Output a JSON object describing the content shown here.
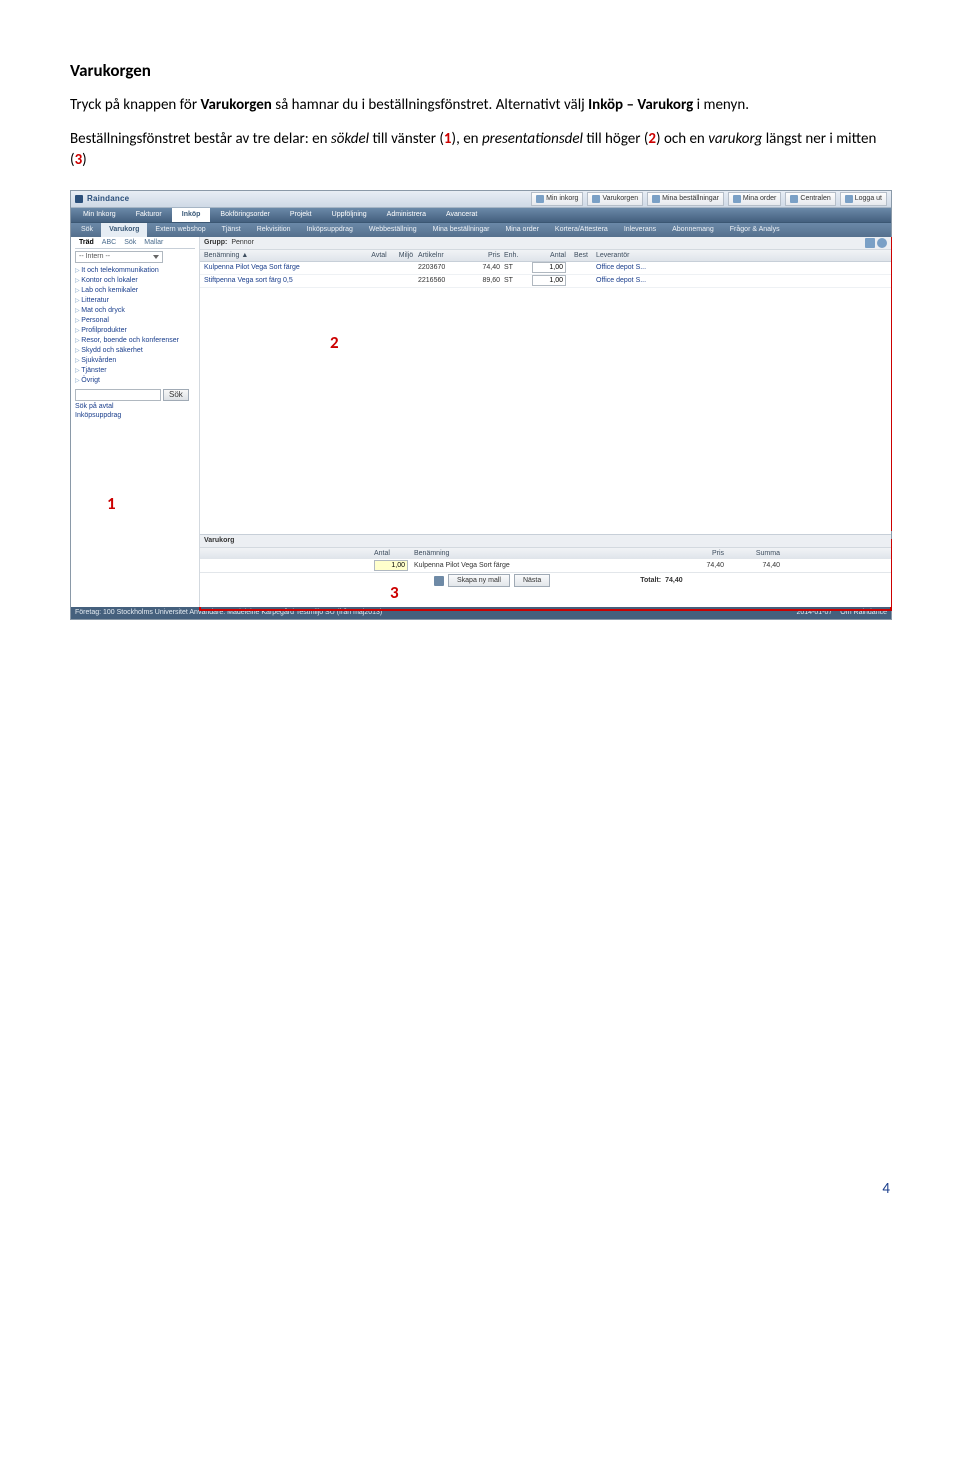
{
  "doc": {
    "title": "Varukorgen",
    "p1_a": "Tryck på knappen för ",
    "p1_b": "Varukorgen",
    "p1_c": " så hamnar du i beställningsfönstret. Alternativt välj ",
    "p1_d": "Inköp – Varukorg",
    "p1_e": " i menyn.",
    "p2_a": "Beställningsfönstret består av tre delar: en ",
    "p2_b": "sökdel",
    "p2_c": " till vänster (",
    "p2_d": "1",
    "p2_e": "), en ",
    "p2_f": "presentationsdel",
    "p2_g": " till höger (",
    "p2_h": "2",
    "p2_i": ") och en ",
    "p2_j": "varukorg",
    "p2_k": " längst ner i mitten (",
    "p2_l": "3",
    "p2_m": ")",
    "page_number": "4"
  },
  "callouts": {
    "one": "1",
    "two": "2",
    "three": "3"
  },
  "app": {
    "brand": "Raindance",
    "topbuttons": [
      {
        "label": "Min inkorg"
      },
      {
        "label": "Varukorgen"
      },
      {
        "label": "Mina beställningar"
      },
      {
        "label": "Mina order"
      },
      {
        "label": "Centralen"
      },
      {
        "label": "Logga ut"
      }
    ],
    "menu": [
      "Min Inkorg",
      "Fakturor",
      "Inköp",
      "Bokföringsorder",
      "Projekt",
      "Uppföljning",
      "Administrera",
      "Avancerat"
    ],
    "menu_active": "Inköp",
    "submenu": [
      "Sök",
      "Varukorg",
      "Extern webshop",
      "Tjänst",
      "Rekvisition",
      "Inköpsuppdrag",
      "Webbeställning",
      "Mina beställningar",
      "Mina order",
      "Kortera/Attestera",
      "Inleverans",
      "Abonnemang",
      "Frågor & Analys"
    ],
    "submenu_active": "Varukorg",
    "sidebar": {
      "tabs": [
        "Träd",
        "ABC",
        "Sök",
        "Mallar"
      ],
      "tab_active": "Träd",
      "dropdown": "-- Intern --",
      "tree": [
        "It och telekommunikation",
        "Kontor och lokaler",
        "Lab och kemikaler",
        "Litteratur",
        "Mat och dryck",
        "Personal",
        "Profilprodukter",
        "Resor, boende och konferenser",
        "Skydd och säkerhet",
        "Sjukvården",
        "Tjänster",
        "Övrigt"
      ],
      "search_btn": "Sök",
      "links": [
        "Sök på avtal",
        "Inköpsuppdrag"
      ]
    },
    "main": {
      "group_label": "Grupp:",
      "group_value": "Pennor",
      "cols": [
        "Benämning",
        "Avtal",
        "Miljö",
        "Artikelnr",
        "Pris",
        "Enh.",
        "Antal",
        "Best",
        "Leverantör"
      ],
      "sort_arrow": "▲",
      "rows": [
        {
          "ben": "Kulpenna Pilot Vega Sort färge",
          "art": "2203670",
          "pris": "74,40",
          "enh": "ST",
          "ant": "1,00",
          "lev": "Office depot S..."
        },
        {
          "ben": "Stiftpenna Vega sort färg 0,5",
          "art": "2216560",
          "pris": "89,60",
          "enh": "ST",
          "ant": "1,00",
          "lev": "Office depot S..."
        }
      ]
    },
    "cart": {
      "title": "Varukorg",
      "cols": [
        "Antal",
        "Benämning",
        "Pris",
        "Summa"
      ],
      "rows": [
        {
          "antal": "1,00",
          "ben": "Kulpenna Pilot Vega Sort färge",
          "pris": "74,40",
          "summa": "74,40"
        }
      ],
      "btn_mall": "Skapa ny mall",
      "btn_next": "Nästa",
      "total_label": "Totalt:",
      "total_value": "74,40"
    },
    "status": {
      "left": "Företag: 100 Stockholms Universitet   Användare: Madeleine Karpegård   Testmiljö SU (från maj2013)",
      "right_date": "2014-01-07",
      "right_about": "Om Raindance"
    }
  }
}
